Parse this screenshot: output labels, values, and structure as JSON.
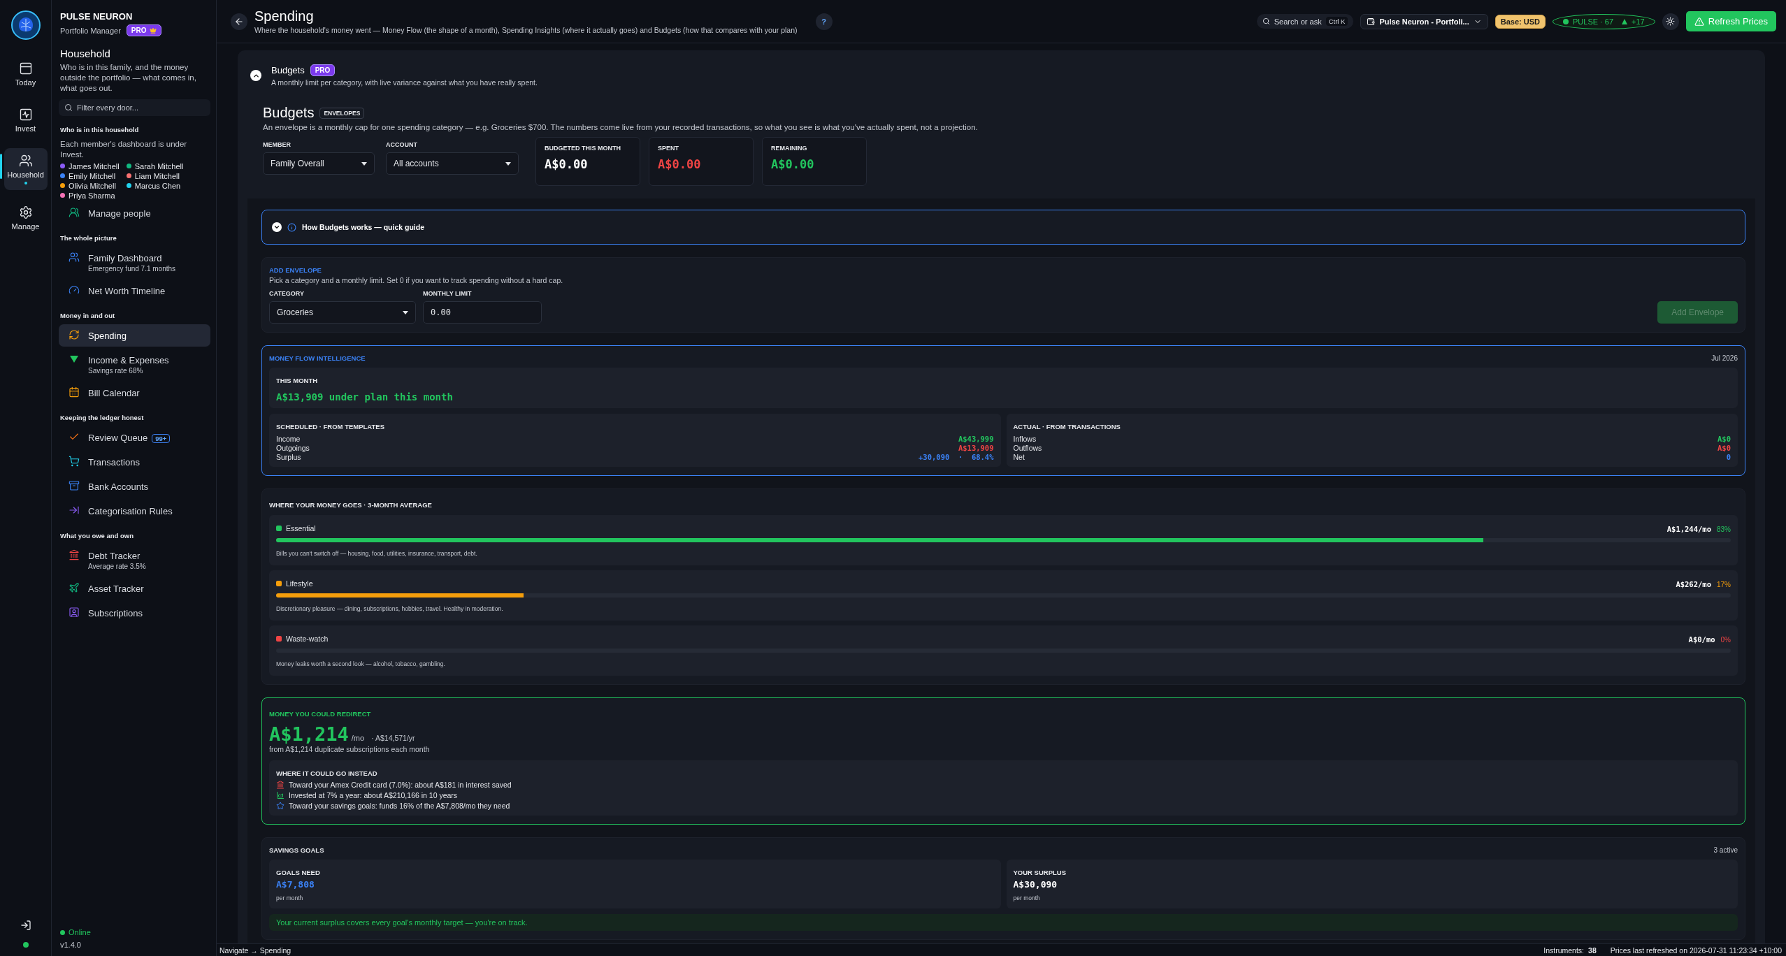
{
  "rail": {
    "items": [
      {
        "label": "Today",
        "selected": false
      },
      {
        "label": "Invest",
        "selected": false
      },
      {
        "label": "Household",
        "selected": true
      },
      {
        "label": "Manage",
        "selected": false
      }
    ]
  },
  "sidebar": {
    "brand": "PULSE NEURON",
    "subtitle": "Portfolio Manager",
    "badge": "PRO",
    "section_title": "Household",
    "description": "Who is in this family, and the money outside the portfolio — what comes in, what goes out.",
    "filter": {
      "placeholder": "Filter every door..."
    },
    "members_heading": "Who is in this household",
    "members_note": "Each member's dashboard is under Invest.",
    "members": [
      {
        "name": "James Mitchell",
        "color": "#8b5cf6"
      },
      {
        "name": "Sarah Mitchell",
        "color": "#10b981"
      },
      {
        "name": "Emily Mitchell",
        "color": "#3b82f6"
      },
      {
        "name": "Liam Mitchell",
        "color": "#f87171"
      },
      {
        "name": "Olivia Mitchell",
        "color": "#f59e0b"
      },
      {
        "name": "Marcus Chen",
        "color": "#22d3ee"
      },
      {
        "name": "Priya Sharma",
        "color": "#f472b6"
      }
    ],
    "groups": [
      {
        "items": [
          {
            "label": "Manage people",
            "selected": false
          }
        ]
      },
      {
        "heading": "The whole picture",
        "items": [
          {
            "label": "Family Dashboard",
            "sub": "Emergency fund  7.1 months",
            "selected": false
          },
          {
            "label": "Net Worth Timeline",
            "selected": false
          }
        ]
      },
      {
        "heading": "Money in and out",
        "items": [
          {
            "label": "Spending",
            "selected": true
          },
          {
            "label": "Income & Expenses",
            "sub": "Savings rate  68%",
            "selected": false
          },
          {
            "label": "Bill Calendar",
            "selected": false
          }
        ]
      },
      {
        "heading": "Keeping the ledger honest",
        "items": [
          {
            "label": "Review Queue",
            "badge": "99+",
            "selected": false
          },
          {
            "label": "Transactions",
            "selected": false
          },
          {
            "label": "Bank Accounts",
            "selected": false
          },
          {
            "label": "Categorisation Rules",
            "selected": false
          }
        ]
      },
      {
        "heading": "What you owe and own",
        "items": [
          {
            "label": "Debt Tracker",
            "sub": "Average rate  3.5%",
            "selected": false
          },
          {
            "label": "Asset Tracker",
            "selected": false
          },
          {
            "label": "Subscriptions",
            "selected": false
          }
        ]
      }
    ],
    "status": "Online",
    "version": "v1.4.0"
  },
  "header": {
    "title": "Spending",
    "subtitle": "Where the household's money went — Money Flow (the shape of a month), Spending Insights (where it actually goes) and Budgets (how that compares with your plan)",
    "help": "?",
    "search": {
      "placeholder": "Search or ask",
      "shortcut": "Ctrl K"
    },
    "portfolio": "Pulse Neuron - Portfoli...",
    "base": "Base: USD",
    "pulse": "PULSE · 67",
    "pulse_change": "+17",
    "refresh": "Refresh Prices"
  },
  "budgets_panel": {
    "title": "Budgets",
    "badge": "PRO",
    "description": "A monthly limit per category, with live variance against what you have really spent.",
    "expanded": true,
    "heading": "Budgets",
    "tag": "ENVELOPES",
    "intro": "An envelope is a monthly cap for one spending category — e.g. Groceries $700. The numbers come live from your recorded transactions, so what you see is what you've actually spent, not a projection.",
    "filters": [
      {
        "label": "MEMBER",
        "value": "Family Overall"
      },
      {
        "label": "ACCOUNT",
        "value": "All accounts"
      }
    ],
    "stats": [
      {
        "label": "BUDGETED THIS MONTH",
        "value": "A$0.00",
        "color": "#ffffff"
      },
      {
        "label": "SPENT",
        "value": "A$0.00",
        "color": "#ef4444"
      },
      {
        "label": "REMAINING",
        "value": "A$0.00",
        "color": "#22c55e"
      }
    ],
    "guide": {
      "title": "How Budgets works — quick guide",
      "expanded": false
    },
    "add_envelope": {
      "title": "ADD ENVELOPE",
      "description": "Pick a category and a monthly limit. Set 0 if you want to track spending without a hard cap.",
      "category_label": "CATEGORY",
      "category": "Groceries",
      "limit_label": "MONTHLY LIMIT",
      "limit": "0.00",
      "button": "Add Envelope",
      "disabled": true
    }
  },
  "money_flow": {
    "title": "MONEY FLOW INTELLIGENCE",
    "period": "Jul 2026",
    "this_month_label": "THIS MONTH",
    "this_month": "A$13,909 under plan this month",
    "tables": [
      {
        "title": "SCHEDULED · FROM TEMPLATES",
        "rows": [
          {
            "label": "Income",
            "value": "A$43,999",
            "color": "#22c55e"
          },
          {
            "label": "Outgoings",
            "value": "A$13,909",
            "color": "#ef4444"
          },
          {
            "label": "Surplus",
            "value": "+30,090  ·  68.4%",
            "color": "#3b82f6"
          }
        ]
      },
      {
        "title": "ACTUAL · FROM TRANSACTIONS",
        "rows": [
          {
            "label": "Inflows",
            "value": "A$0",
            "color": "#22c55e"
          },
          {
            "label": "Outflows",
            "value": "A$0",
            "color": "#ef4444"
          },
          {
            "label": "Net",
            "value": "0",
            "color": "#3b82f6"
          }
        ]
      }
    ]
  },
  "where": {
    "title": "WHERE YOUR MONEY GOES · 3-MONTH AVERAGE",
    "categories": [
      {
        "name": "Essential",
        "color": "#22c55e",
        "amount": "A$1,244/mo",
        "share": "83%",
        "level": 0.83,
        "note": "Bills you can't switch off — housing, food, utilities, insurance, transport, debt."
      },
      {
        "name": "Lifestyle",
        "color": "#f59e0b",
        "amount": "A$262/mo",
        "share": "17%",
        "level": 0.17,
        "note": "Discretionary pleasure — dining, subscriptions, hobbies, travel. Healthy in moderation."
      },
      {
        "name": "Waste-watch",
        "color": "#ef4444",
        "amount": "A$0/mo",
        "share": "0%",
        "level": 0,
        "note": "Money leaks worth a second look — alcohol, tobacco, gambling."
      }
    ]
  },
  "redirect": {
    "title": "MONEY YOU COULD REDIRECT",
    "amount": "A$1,214",
    "unit": "/mo",
    "yearly": "· A$14,571/yr",
    "note": "from A$1,214 duplicate subscriptions each month",
    "ideas_title": "WHERE IT COULD GO INSTEAD",
    "ideas": [
      "Toward your Amex Credit card (7.0%): about A$181 in interest saved",
      "Invested at 7% a year: about A$210,166 in 10 years",
      "Toward your savings goals: funds 16% of the A$7,808/mo they need"
    ]
  },
  "savings": {
    "title": "SAVINGS GOALS",
    "count": "3 active",
    "cards": [
      {
        "label": "GOALS NEED",
        "value": "A$7,808",
        "sub": "per month",
        "color": "#3b82f6"
      },
      {
        "label": "YOUR SURPLUS",
        "value": "A$30,090",
        "sub": "per month",
        "color": "#ffffff"
      }
    ],
    "message": "Your current surplus covers every goal's monthly target — you're on track."
  },
  "status_bar": {
    "breadcrumb": "Navigate → Spending",
    "instruments_label": "Instruments:",
    "instruments": "38",
    "refreshed": "Prices last refreshed on 2026-07-31 11:23:34 +10:00"
  }
}
